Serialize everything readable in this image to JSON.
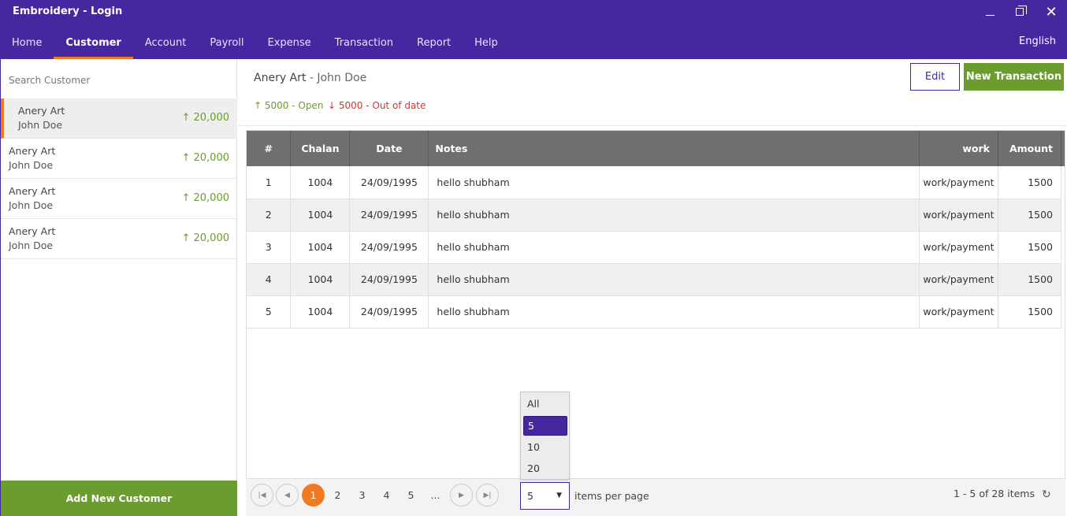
{
  "app": {
    "title": "Embroidery - Login"
  },
  "window_controls": {
    "minimize": "minimize-icon",
    "maximize": "restore-icon",
    "close": "close-icon"
  },
  "nav": {
    "items": [
      "Home",
      "Customer",
      "Account",
      "Payroll",
      "Expense",
      "Transaction",
      "Report",
      "Help"
    ],
    "active": "Customer",
    "language": "English"
  },
  "sidebar": {
    "search_placeholder": "Search Customer",
    "customers": [
      {
        "name": "Anery Art",
        "contact": "John Doe",
        "amount": "↑ 20,000",
        "selected": true
      },
      {
        "name": "Anery Art",
        "contact": "John Doe",
        "amount": "↑ 20,000",
        "selected": false
      },
      {
        "name": "Anery Art",
        "contact": "John Doe",
        "amount": "↑ 20,000",
        "selected": false
      },
      {
        "name": "Anery Art",
        "contact": "John Doe",
        "amount": "↑ 20,000",
        "selected": false
      }
    ],
    "add_button": "Add New Customer"
  },
  "main": {
    "customer_name": "Anery Art",
    "separator": " - ",
    "contact_name": "John Doe",
    "stat_open": "↑ 5000 - Open",
    "stat_out": "↓ 5000 - Out of date",
    "edit_button": "Edit",
    "new_transaction_button": "New Transaction"
  },
  "table": {
    "headers": [
      "#",
      "Chalan",
      "Date",
      "Notes",
      "work",
      "Amount"
    ],
    "rows": [
      [
        "1",
        "1004",
        "24/09/1995",
        "hello shubham",
        "work/payment",
        "1500"
      ],
      [
        "2",
        "1004",
        "24/09/1995",
        "hello shubham",
        "work/payment",
        "1500"
      ],
      [
        "3",
        "1004",
        "24/09/1995",
        "hello shubham",
        "work/payment",
        "1500"
      ],
      [
        "4",
        "1004",
        "24/09/1995",
        "hello shubham",
        "work/payment",
        "1500"
      ],
      [
        "5",
        "1004",
        "24/09/1995",
        "hello shubham",
        "work/payment",
        "1500"
      ]
    ]
  },
  "pager": {
    "first_icon": "first-page-icon",
    "prev_icon": "prev-page-icon",
    "pages": [
      "1",
      "2",
      "3",
      "4",
      "5",
      "..."
    ],
    "current": "1",
    "next_icon": "next-page-icon",
    "last_icon": "last-page-icon",
    "per_page_value": "5",
    "per_page_label": "items per page",
    "info": "1 - 5 of 28 items",
    "refresh_icon": "refresh-icon"
  },
  "per_page_dropdown": {
    "options": [
      "All",
      "5",
      "10",
      "20"
    ],
    "selected": "5"
  },
  "colors": {
    "header": "#4527a0",
    "accent": "#f07a22",
    "green": "#6a9d2e",
    "red": "#d9342b",
    "table_header": "#6f6f6f"
  }
}
